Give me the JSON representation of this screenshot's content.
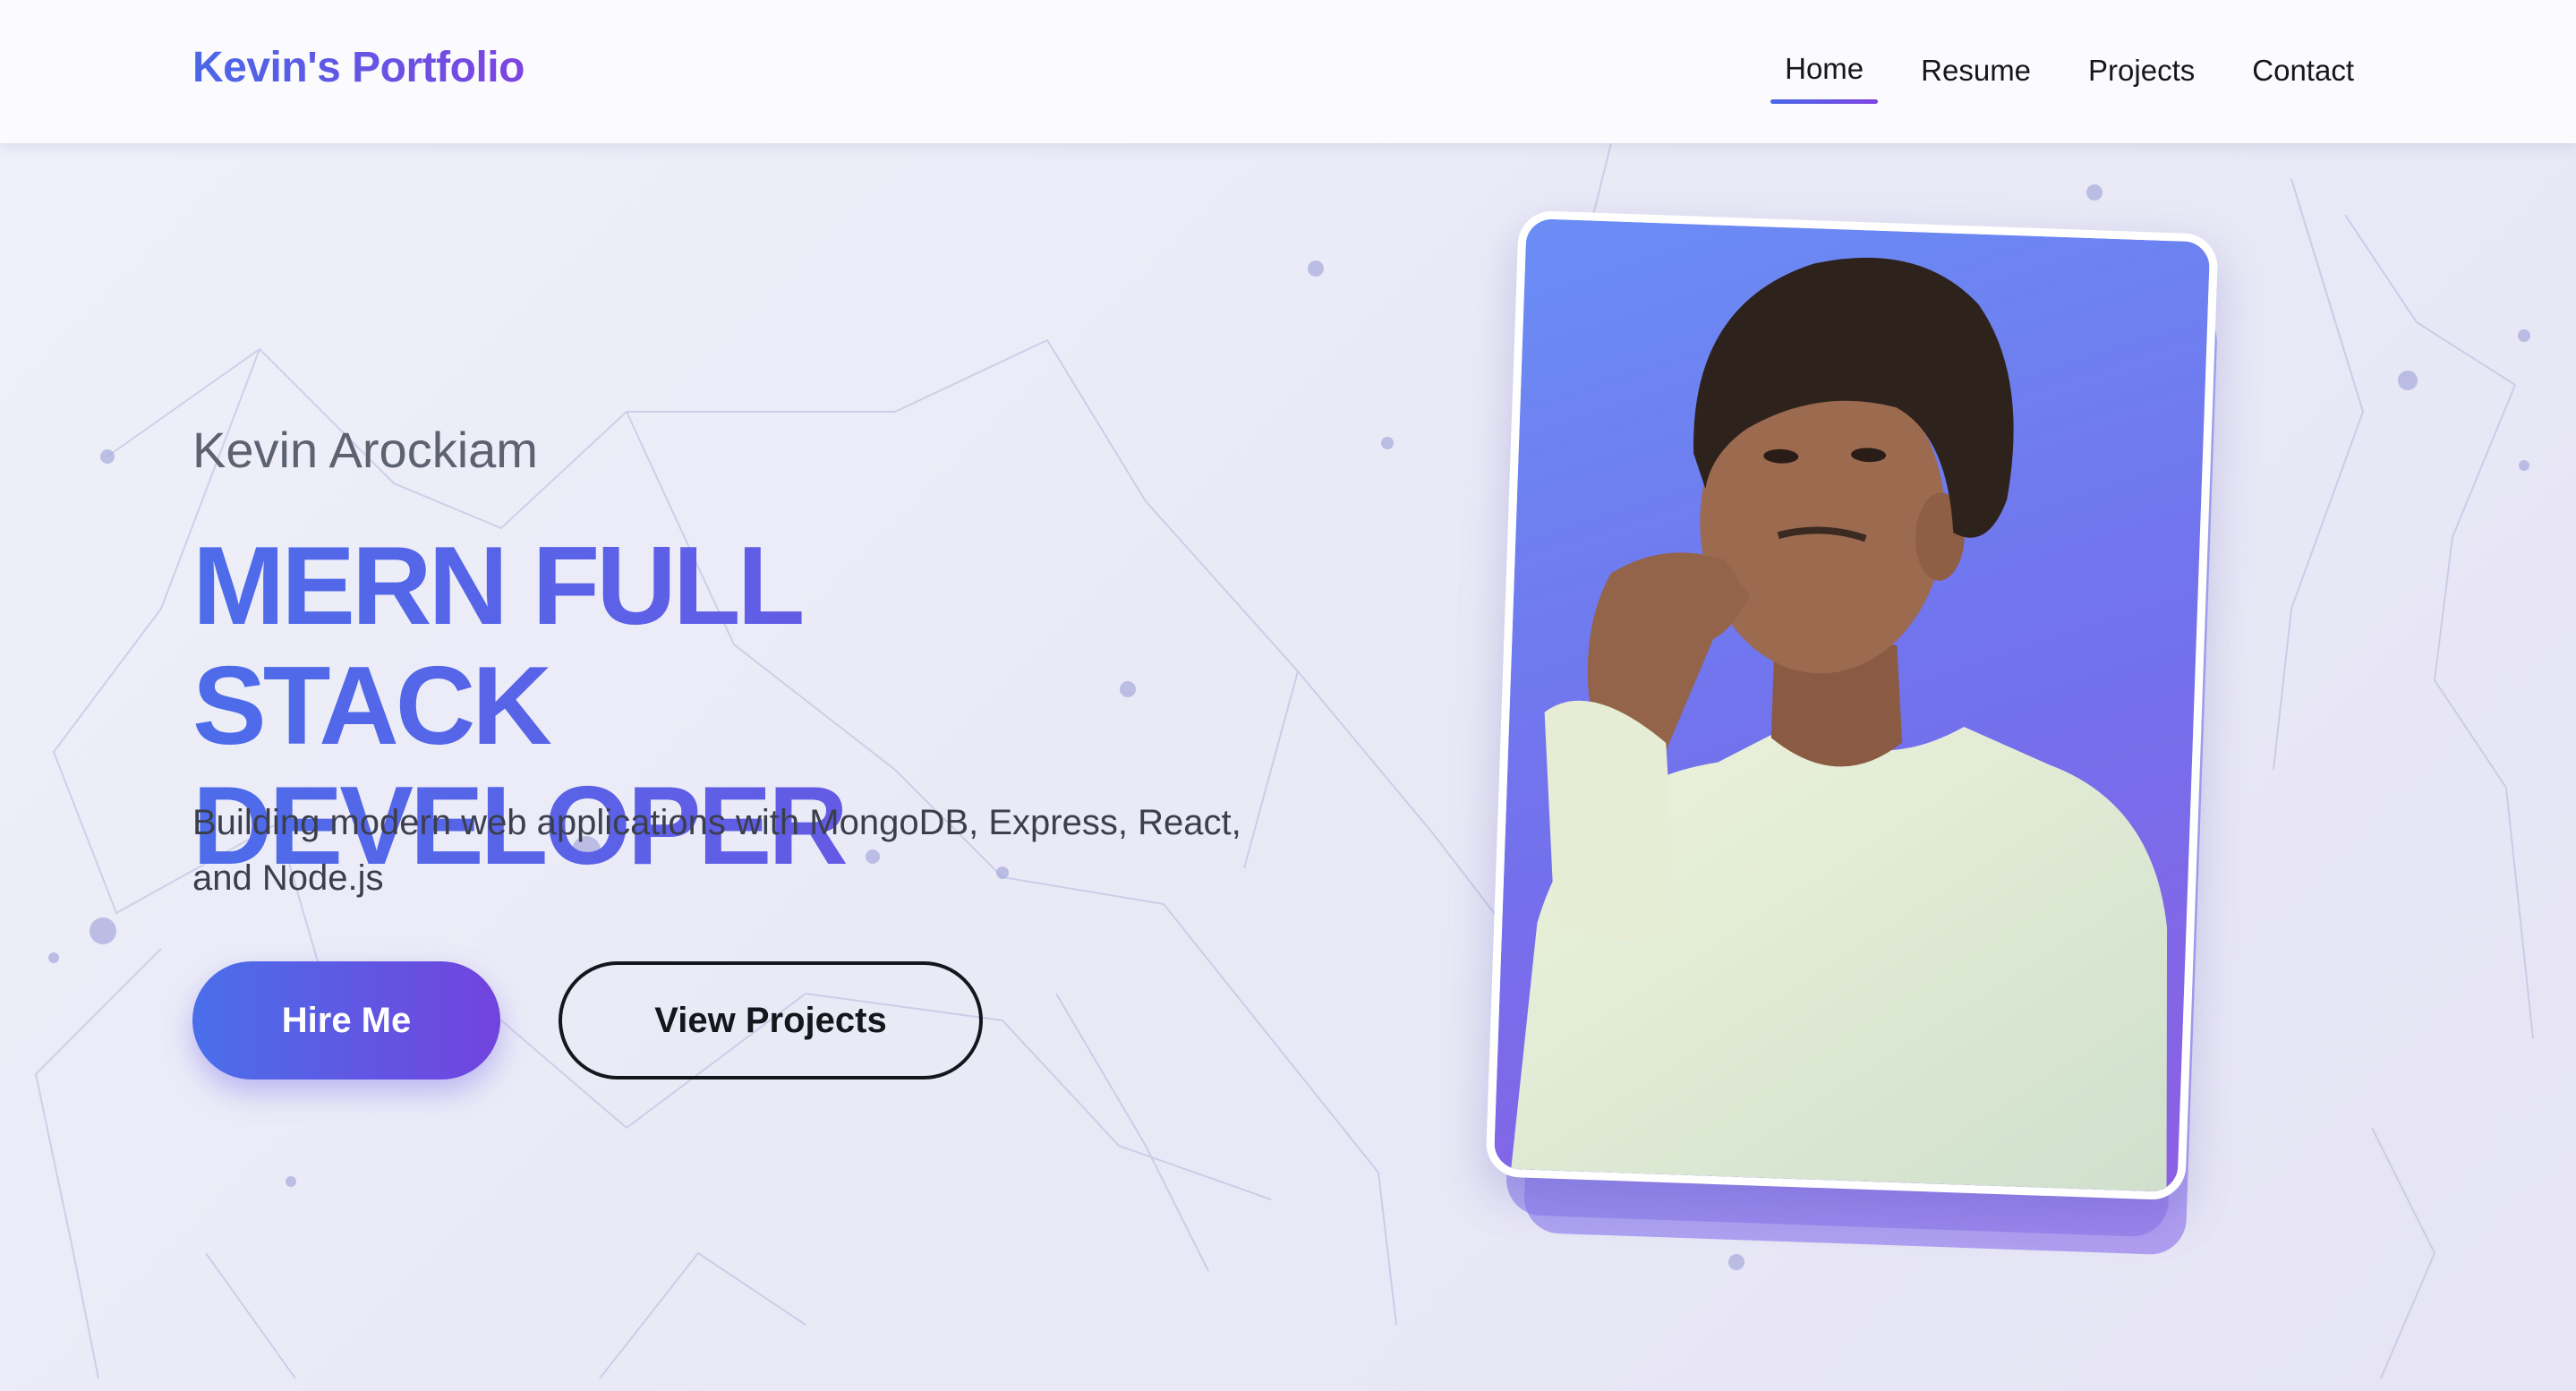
{
  "header": {
    "brand": "Kevin's Portfolio",
    "nav": [
      {
        "label": "Home",
        "active": true
      },
      {
        "label": "Resume",
        "active": false
      },
      {
        "label": "Projects",
        "active": false
      },
      {
        "label": "Contact",
        "active": false
      }
    ]
  },
  "hero": {
    "name": "Kevin Arockiam",
    "title_line1": "MERN FULL STACK",
    "title_line2": "DEVELOPER",
    "description": "Building modern web applications with MongoDB, Express, React, and Node.js",
    "primary_button": "Hire Me",
    "secondary_button": "View Projects"
  },
  "theme": {
    "accent_start": "#4a68e8",
    "accent_end": "#7e44e0",
    "background": "#ebebf7",
    "text_dark": "#16161c"
  },
  "icons": {
    "background": "network-particles",
    "portrait": "person-photo"
  }
}
